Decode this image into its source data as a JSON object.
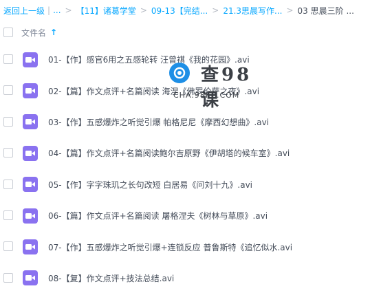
{
  "breadcrumb": {
    "back": "返回上一级",
    "ellipsis": "...",
    "items": [
      "【11】诸葛学堂",
      "09-13【完结...",
      "21.3思晨写作..."
    ],
    "current": "03 思晨三阶 ...",
    "separator": "|",
    "arrow": ">"
  },
  "list_header": {
    "column_label": "文件名",
    "sort_icon": "arrow-up-icon"
  },
  "files": [
    {
      "name": "01-【作】感官6用之五感轮转 汪曾祺《我的花园》.avi"
    },
    {
      "name": "02-【篇】作文点评+名篇阅读 海涅《佛罗伦萨之夜》.avi"
    },
    {
      "name": "03-【作】五感爆炸之听觉引爆 帕格尼尼《摩西幻想曲》.avi"
    },
    {
      "name": "04-【篇】作文点评+名篇阅读鲍尔吉原野《伊胡塔的候车室》.avi"
    },
    {
      "name": "05-【作】字字珠玑之长句改短 白居易《问刘十九》.avi"
    },
    {
      "name": "06-【篇】作文点评+名篇阅读 屠格涅夫《树林与草原》.avi"
    },
    {
      "name": "07-【作】五感爆炸之听觉引爆+连锁反应 普鲁斯特《追忆似水.avi"
    },
    {
      "name": "08-【复】作文点评+技法总结.avi"
    }
  ],
  "watermark": {
    "title": "查98课",
    "subtitle": "CHA.98KE.COM"
  },
  "colors": {
    "link": "#06a7ff",
    "video_icon": "#8a72f0",
    "text": "#454d5a"
  }
}
